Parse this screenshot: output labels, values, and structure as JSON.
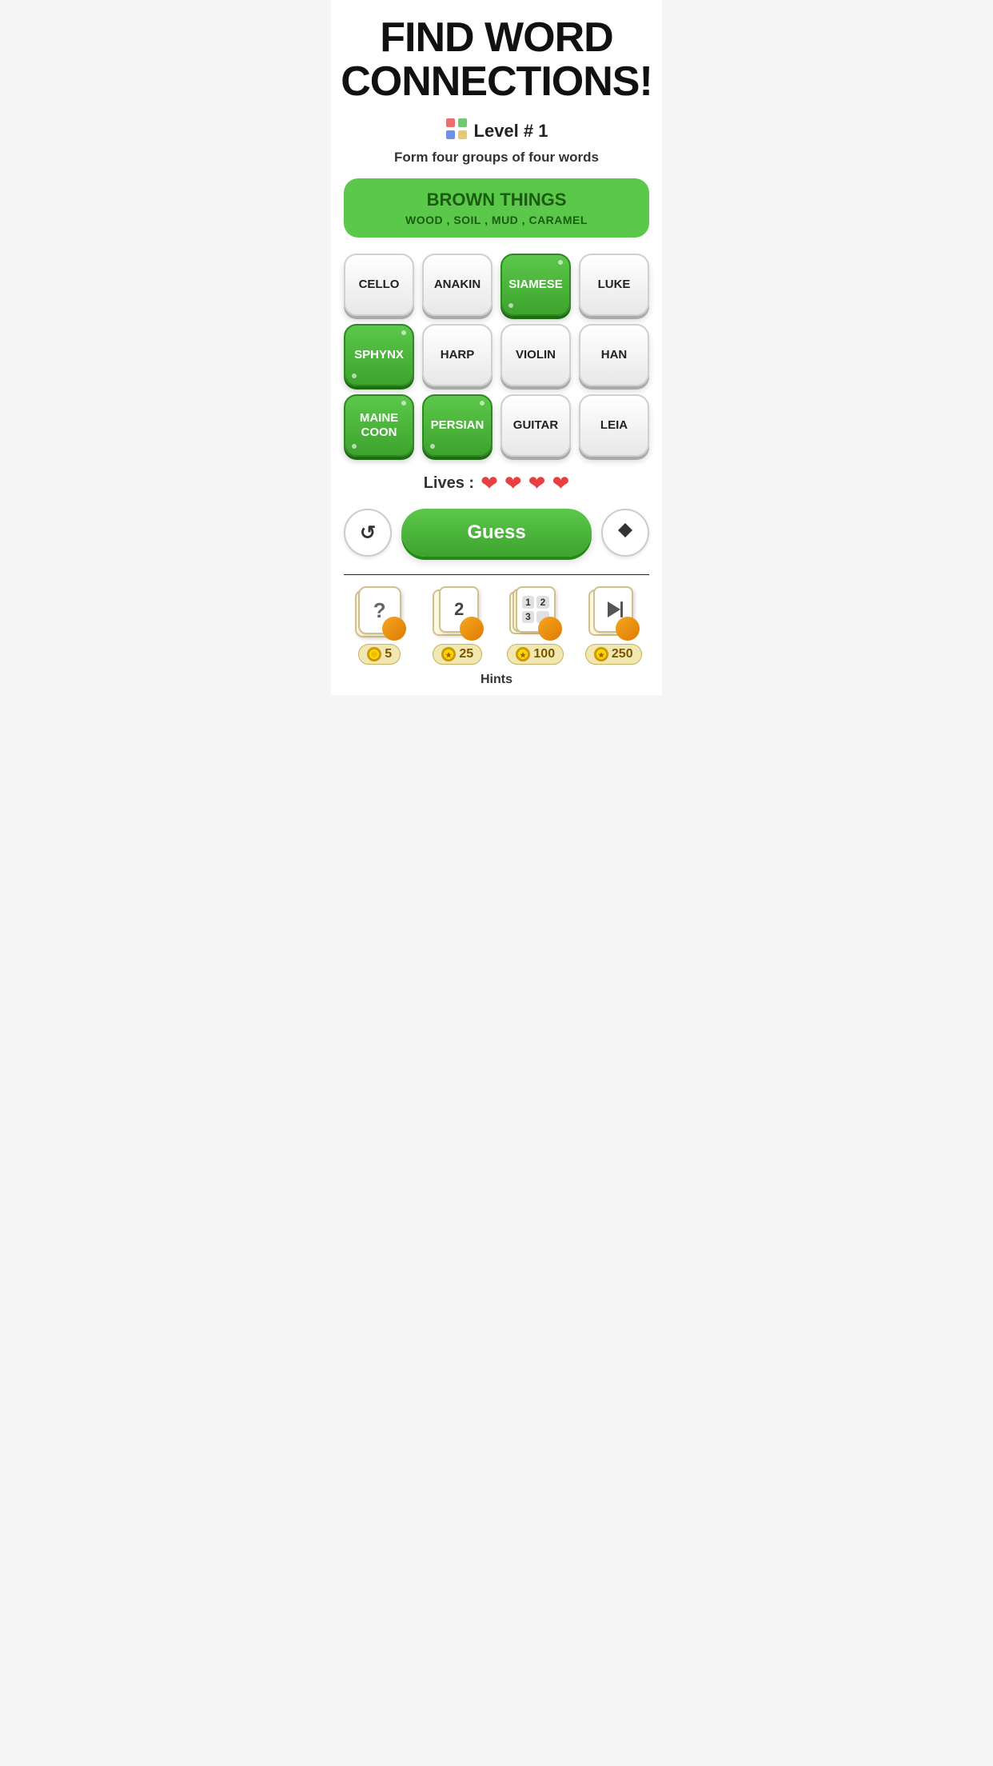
{
  "header": {
    "title_line1": "FIND WORD",
    "title_line2": "CONNECTIONS!"
  },
  "level": {
    "icon": "🟦",
    "text": "Level # 1"
  },
  "subtitle": "Form four groups of four words",
  "solved_group": {
    "title": "BROWN THINGS",
    "words": "WOOD , SOIL , MUD , CARAMEL"
  },
  "tiles": [
    {
      "word": "CELLO",
      "selected": false
    },
    {
      "word": "ANAKIN",
      "selected": false
    },
    {
      "word": "SIAMESE",
      "selected": true
    },
    {
      "word": "LUKE",
      "selected": false
    },
    {
      "word": "SPHYNX",
      "selected": true
    },
    {
      "word": "HARP",
      "selected": false
    },
    {
      "word": "VIOLIN",
      "selected": false
    },
    {
      "word": "HAN",
      "selected": false
    },
    {
      "word": "MAINE\nCOON",
      "selected": true
    },
    {
      "word": "PERSIAN",
      "selected": true
    },
    {
      "word": "GUITAR",
      "selected": false
    },
    {
      "word": "LEIA",
      "selected": false
    }
  ],
  "lives": {
    "label": "Lives :",
    "count": 4
  },
  "actions": {
    "refresh_label": "↺",
    "guess_label": "Guess",
    "erase_label": "◆"
  },
  "hints": [
    {
      "type": "question",
      "coins": "5",
      "label": "Hint"
    },
    {
      "type": "numbers12",
      "coins": "25",
      "label": "Hint"
    },
    {
      "type": "numbers1234",
      "coins": "100",
      "label": "Hint"
    },
    {
      "type": "play",
      "coins": "250",
      "label": "Hint"
    }
  ],
  "hints_section_label": "Hints",
  "colors": {
    "green": "#5cc84b",
    "dark_green": "#3da32d",
    "selected_bg": "#5cc84b",
    "heart": "#e84040",
    "tile_bg": "#ffffff"
  }
}
